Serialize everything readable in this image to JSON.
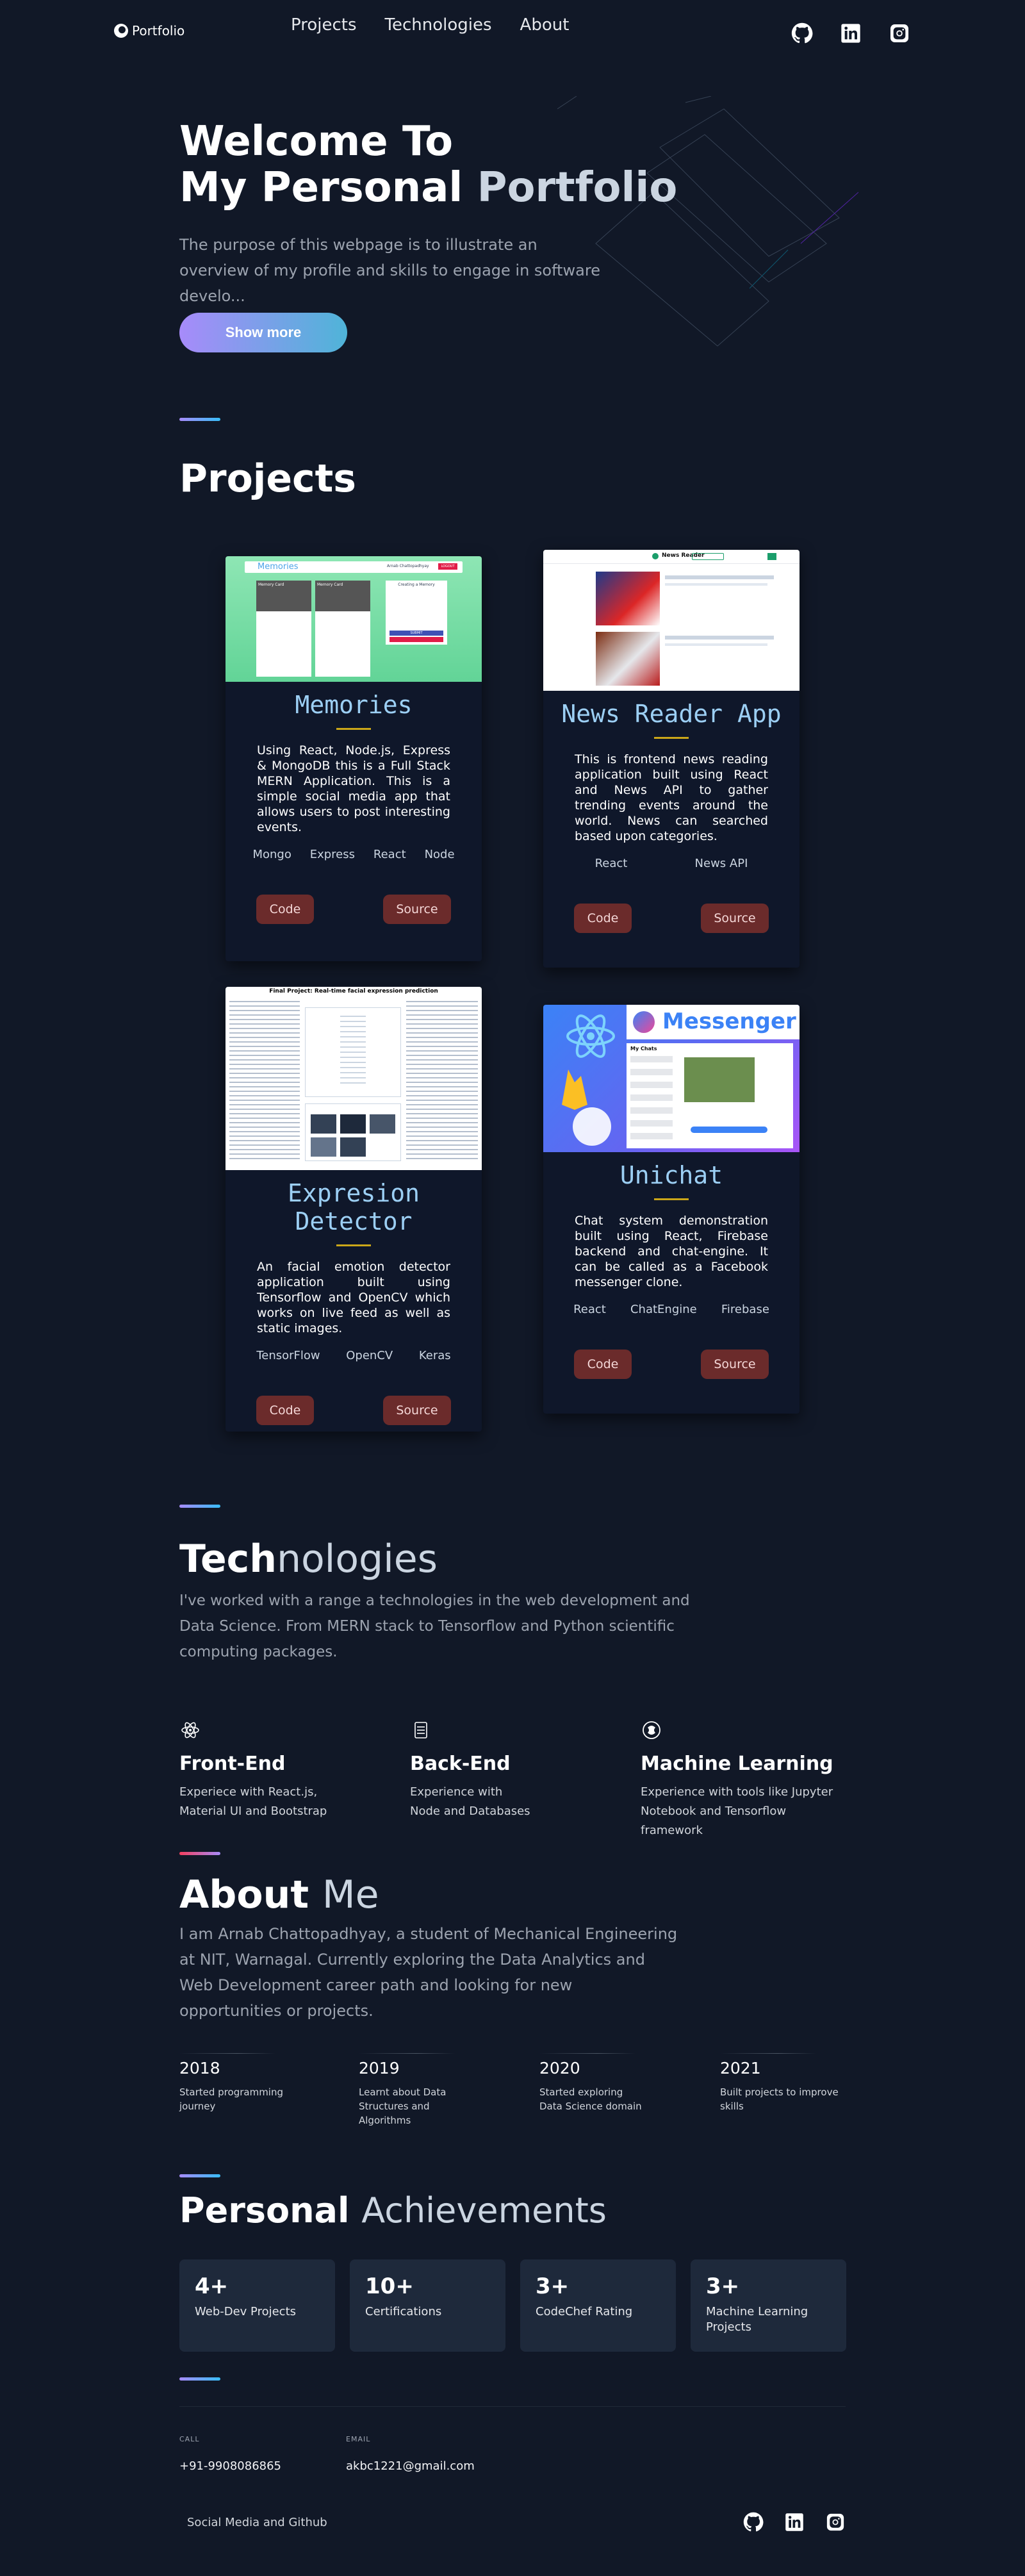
{
  "nav": {
    "logo": "Portfolio",
    "links": [
      "Projects",
      "Technologies",
      "About"
    ],
    "social_icons": [
      "github-icon",
      "linkedin-icon",
      "instagram-icon"
    ]
  },
  "hero": {
    "title_line1": "Welcome To",
    "title_line2_a": "My Personal ",
    "title_line2_b": "Portfolio",
    "description": "The purpose of this webpage is to illustrate an overview of my profile and skills to engage in software develo...",
    "button": "Show more"
  },
  "projects": {
    "title": "Projects",
    "cards": [
      {
        "title": "Memories",
        "description": "Using React, Node.js, Express & MongoDB this is a Full Stack MERN Application. This is a simple social media app that allows users to post interesting events.",
        "tags": [
          "Mongo",
          "Express",
          "React",
          "Node"
        ],
        "code": "Code",
        "source": "Source",
        "image_header": "Memories",
        "image_cards": [
          "Memory Card",
          "Memory Card"
        ],
        "image_form_title": "Creating a Memory",
        "image_form_button": "SUBMIT",
        "image_user": "Arnab Chattopadhyay",
        "image_logout": "LOGOUT"
      },
      {
        "title": "News Reader App",
        "description": "This is frontend news reading application built using React and News API to gather trending events around the world. News can searched based upon categories.",
        "tags": [
          "React",
          "News API"
        ],
        "code": "Code",
        "source": "Source",
        "image_header": "News Reader"
      },
      {
        "title": "Expresion Detector",
        "description": "An facial emotion detector application built using Tensorflow and OpenCV which works on live feed as well as static images.",
        "tags": [
          "TensorFlow",
          "OpenCV",
          "Keras"
        ],
        "code": "Code",
        "source": "Source",
        "image_header": "Final Project: Real-time facial expression prediction"
      },
      {
        "title": "Unichat",
        "description": "Chat system demonstration built using React, Firebase backend and chat-engine. It can be called as a Facebook messenger clone.",
        "tags": [
          "React",
          "ChatEngine",
          "Firebase"
        ],
        "code": "Code",
        "source": "Source",
        "image_header": "Messenger",
        "image_chat_title": "My Chats"
      }
    ]
  },
  "technologies": {
    "title_a": "Tech",
    "title_b": "nologies",
    "description": "I've worked with a range a technologies in the web development and Data Science. From MERN stack to Tensorflow and Python scientific computing packages.",
    "items": [
      {
        "icon": "react-atom-icon",
        "title": "Front-End",
        "text": "Experiece with React.js, Material UI and Bootstrap"
      },
      {
        "icon": "server-icon",
        "title": "Back-End",
        "text": "Experience with Node and Databases"
      },
      {
        "icon": "brain-icon",
        "title": "Machine Learning",
        "text": "Experience with tools like Jupyter Notebook and Tensorflow framework"
      }
    ]
  },
  "about": {
    "title_a": "About ",
    "title_b": "Me",
    "description": "I am Arnab Chattopadhyay, a student of Mechanical Engineering at NIT, Warnagal. Currently exploring the Data Analytics and Web Development career path and looking for new opportunities or projects.",
    "timeline": [
      {
        "year": "2018",
        "text": "Started programming journey"
      },
      {
        "year": "2019",
        "text": "Learnt about Data Structures and Algorithms"
      },
      {
        "year": "2020",
        "text": "Started exploring Data Science domain"
      },
      {
        "year": "2021",
        "text": "Built projects to improve skills"
      }
    ]
  },
  "achievements": {
    "title_a": "Personal ",
    "title_b": "Achievements",
    "items": [
      {
        "num": "4+",
        "label": "Web-Dev Projects"
      },
      {
        "num": "10+",
        "label": "Certifications"
      },
      {
        "num": "3+",
        "label": "CodeChef Rating"
      },
      {
        "num": "3+",
        "label": "Machine Learning Projects"
      }
    ]
  },
  "contact": {
    "call_label": "CALL",
    "call_value": "+91-9908086865",
    "email_label": "EMAIL",
    "email_value": "akbc1221@gmail.com",
    "footer_text": "Social Media and Github"
  },
  "colors": {
    "background": "#111827",
    "accent_gradient_start": "#a78bfa",
    "accent_gradient_end": "#38bdf8",
    "card_title": "#9ccff4",
    "button_red": "#6b2b2b"
  }
}
